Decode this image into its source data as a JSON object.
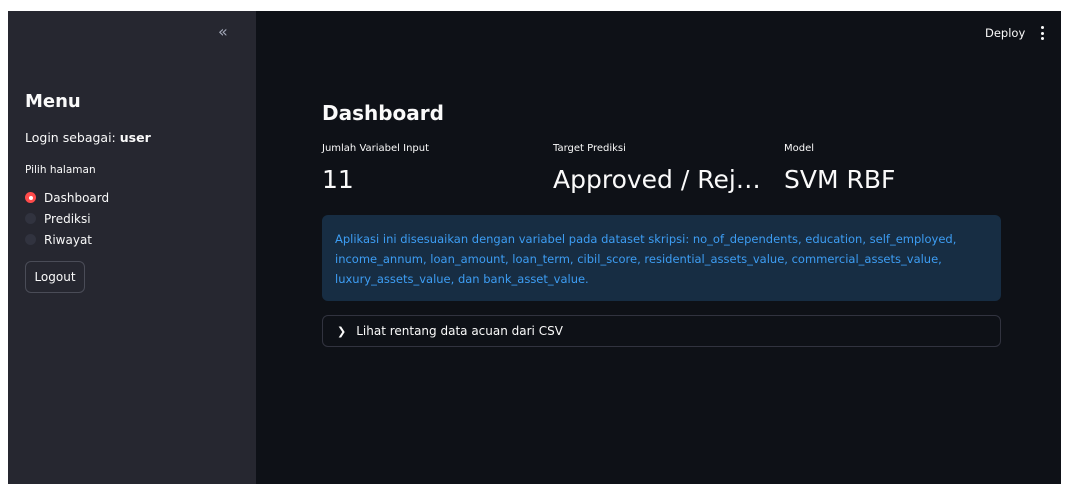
{
  "sidebar": {
    "collapse_icon": "«",
    "title": "Menu",
    "login_prefix": "Login sebagai: ",
    "login_user": "user",
    "pick_label": "Pilih halaman",
    "pages": [
      {
        "label": "Dashboard",
        "selected": true
      },
      {
        "label": "Prediksi",
        "selected": false
      },
      {
        "label": "Riwayat",
        "selected": false
      }
    ],
    "logout_label": "Logout"
  },
  "header": {
    "deploy_label": "Deploy"
  },
  "main": {
    "title": "Dashboard",
    "metrics": [
      {
        "label": "Jumlah Variabel Input",
        "value": "11"
      },
      {
        "label": "Target Prediksi",
        "value": "Approved / Rej…"
      },
      {
        "label": "Model",
        "value": "SVM RBF"
      }
    ],
    "info_text": "Aplikasi ini disesuaikan dengan variabel pada dataset skripsi: no_of_dependents, education, self_employed, income_annum, loan_amount, loan_term, cibil_score, residential_assets_value, commercial_assets_value, luxury_assets_value, dan bank_asset_value.",
    "expander_label": "Lihat rentang data acuan dari CSV",
    "expander_icon": "chevron-right-icon"
  },
  "colors": {
    "app_bg": "#0e1117",
    "sidebar_bg": "#262730",
    "accent": "#ff4b4b",
    "info_bg": "#172d43",
    "info_text": "#3d9df3"
  }
}
